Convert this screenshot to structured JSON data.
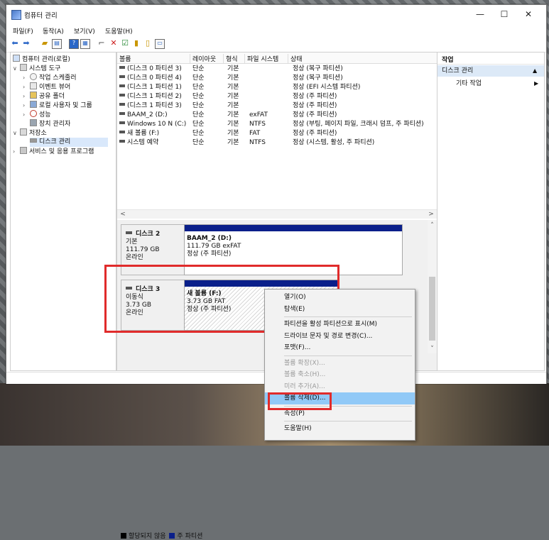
{
  "window": {
    "title": "컴퓨터 관리",
    "controls": {
      "minimize": "—",
      "maximize": "☐",
      "close": "✕"
    }
  },
  "menu": [
    "파일(F)",
    "동작(A)",
    "보기(V)",
    "도움말(H)"
  ],
  "toolbar_icons": [
    "back-arrow-icon",
    "forward-arrow-icon",
    "up-folder-icon",
    "console-tree-icon",
    "help-icon",
    "properties-icon",
    "connect-icon",
    "delete-icon",
    "check-icon",
    "folder-gold-icon",
    "export-icon",
    "window-icon"
  ],
  "tree": {
    "root": "컴퓨터 관리(로컬)",
    "items": [
      {
        "label": "시스템 도구"
      },
      {
        "label": "작업 스케줄러"
      },
      {
        "label": "이벤트 뷰어"
      },
      {
        "label": "공유 폴더"
      },
      {
        "label": "로컬 사용자 및 그룹"
      },
      {
        "label": "성능"
      },
      {
        "label": "장치 관리자"
      },
      {
        "label": "저장소"
      },
      {
        "label": "디스크 관리"
      },
      {
        "label": "서비스 및 응용 프로그램"
      }
    ]
  },
  "volume_list": {
    "columns": [
      "볼륨",
      "레이아웃",
      "형식",
      "파일 시스템",
      "상태"
    ],
    "rows": [
      [
        "(디스크 0 파티션 3)",
        "단순",
        "기본",
        "",
        "정상 (복구 파티션)"
      ],
      [
        "(디스크 0 파티션 4)",
        "단순",
        "기본",
        "",
        "정상 (복구 파티션)"
      ],
      [
        "(디스크 1 파티션 1)",
        "단순",
        "기본",
        "",
        "정상 (EFI 시스템 파티션)"
      ],
      [
        "(디스크 1 파티션 2)",
        "단순",
        "기본",
        "",
        "정상 (주 파티션)"
      ],
      [
        "(디스크 1 파티션 3)",
        "단순",
        "기본",
        "",
        "정상 (주 파티션)"
      ],
      [
        "BAAM_2 (D:)",
        "단순",
        "기본",
        "exFAT",
        "정상 (주 파티션)"
      ],
      [
        "Windows 10 N (C:)",
        "단순",
        "기본",
        "NTFS",
        "정상 (부팅, 페이지 파일, 크래시 덤프, 주 파티션)"
      ],
      [
        "새 볼륨 (F:)",
        "단순",
        "기본",
        "FAT",
        "정상 (주 파티션)"
      ],
      [
        "시스템 예약",
        "단순",
        "기본",
        "NTFS",
        "정상 (시스템, 활성, 주 파티션)"
      ]
    ]
  },
  "disks": [
    {
      "name": "디스크 2",
      "type": "기본",
      "size": "111.79 GB",
      "status": "온라인",
      "partition": {
        "title": "BAAM_2  (D:)",
        "info": "111.79 GB exFAT",
        "status": "정상 (주 파티션)"
      }
    },
    {
      "name": "디스크 3",
      "type": "이동식",
      "size": "3.73 GB",
      "status": "온라인",
      "partition": {
        "title": "새 볼륨  (F:)",
        "info": "3.73 GB FAT",
        "status": "정상 (주 파티션)"
      }
    }
  ],
  "legend": [
    {
      "label": "할당되지 않음",
      "color": "#000000"
    },
    {
      "label": "주 파티션",
      "color": "#0a1f8a"
    }
  ],
  "actions": {
    "header": "작업",
    "section": "디스크 관리",
    "more": "기타 작업",
    "collapse_glyph": "▲",
    "more_glyph": "▶"
  },
  "context_menu": [
    {
      "label": "열기(O)",
      "enabled": true
    },
    {
      "label": "탐색(E)",
      "enabled": true
    },
    {
      "sep": true
    },
    {
      "label": "파티션을 활성 파티션으로 표시(M)",
      "enabled": true
    },
    {
      "label": "드라이브 문자 및 경로 변경(C)...",
      "enabled": true
    },
    {
      "label": "포맷(F)...",
      "enabled": true
    },
    {
      "sep": true
    },
    {
      "label": "볼륨 확장(X)...",
      "enabled": false
    },
    {
      "label": "볼륨 축소(H)...",
      "enabled": false
    },
    {
      "label": "미러 추가(A)...",
      "enabled": false
    },
    {
      "label": "볼륨 삭제(D)...",
      "enabled": true,
      "highlighted": true
    },
    {
      "sep": true
    },
    {
      "label": "속성(P)",
      "enabled": true
    },
    {
      "sep": true
    },
    {
      "label": "도움말(H)",
      "enabled": true
    }
  ],
  "scroll": {
    "left": "<",
    "right": ">",
    "up": "˄",
    "down": "˅"
  },
  "colors": {
    "highlight": "#e02b2b",
    "partition_bar": "#0a1f8a",
    "menu_hover": "#91c9f7"
  }
}
